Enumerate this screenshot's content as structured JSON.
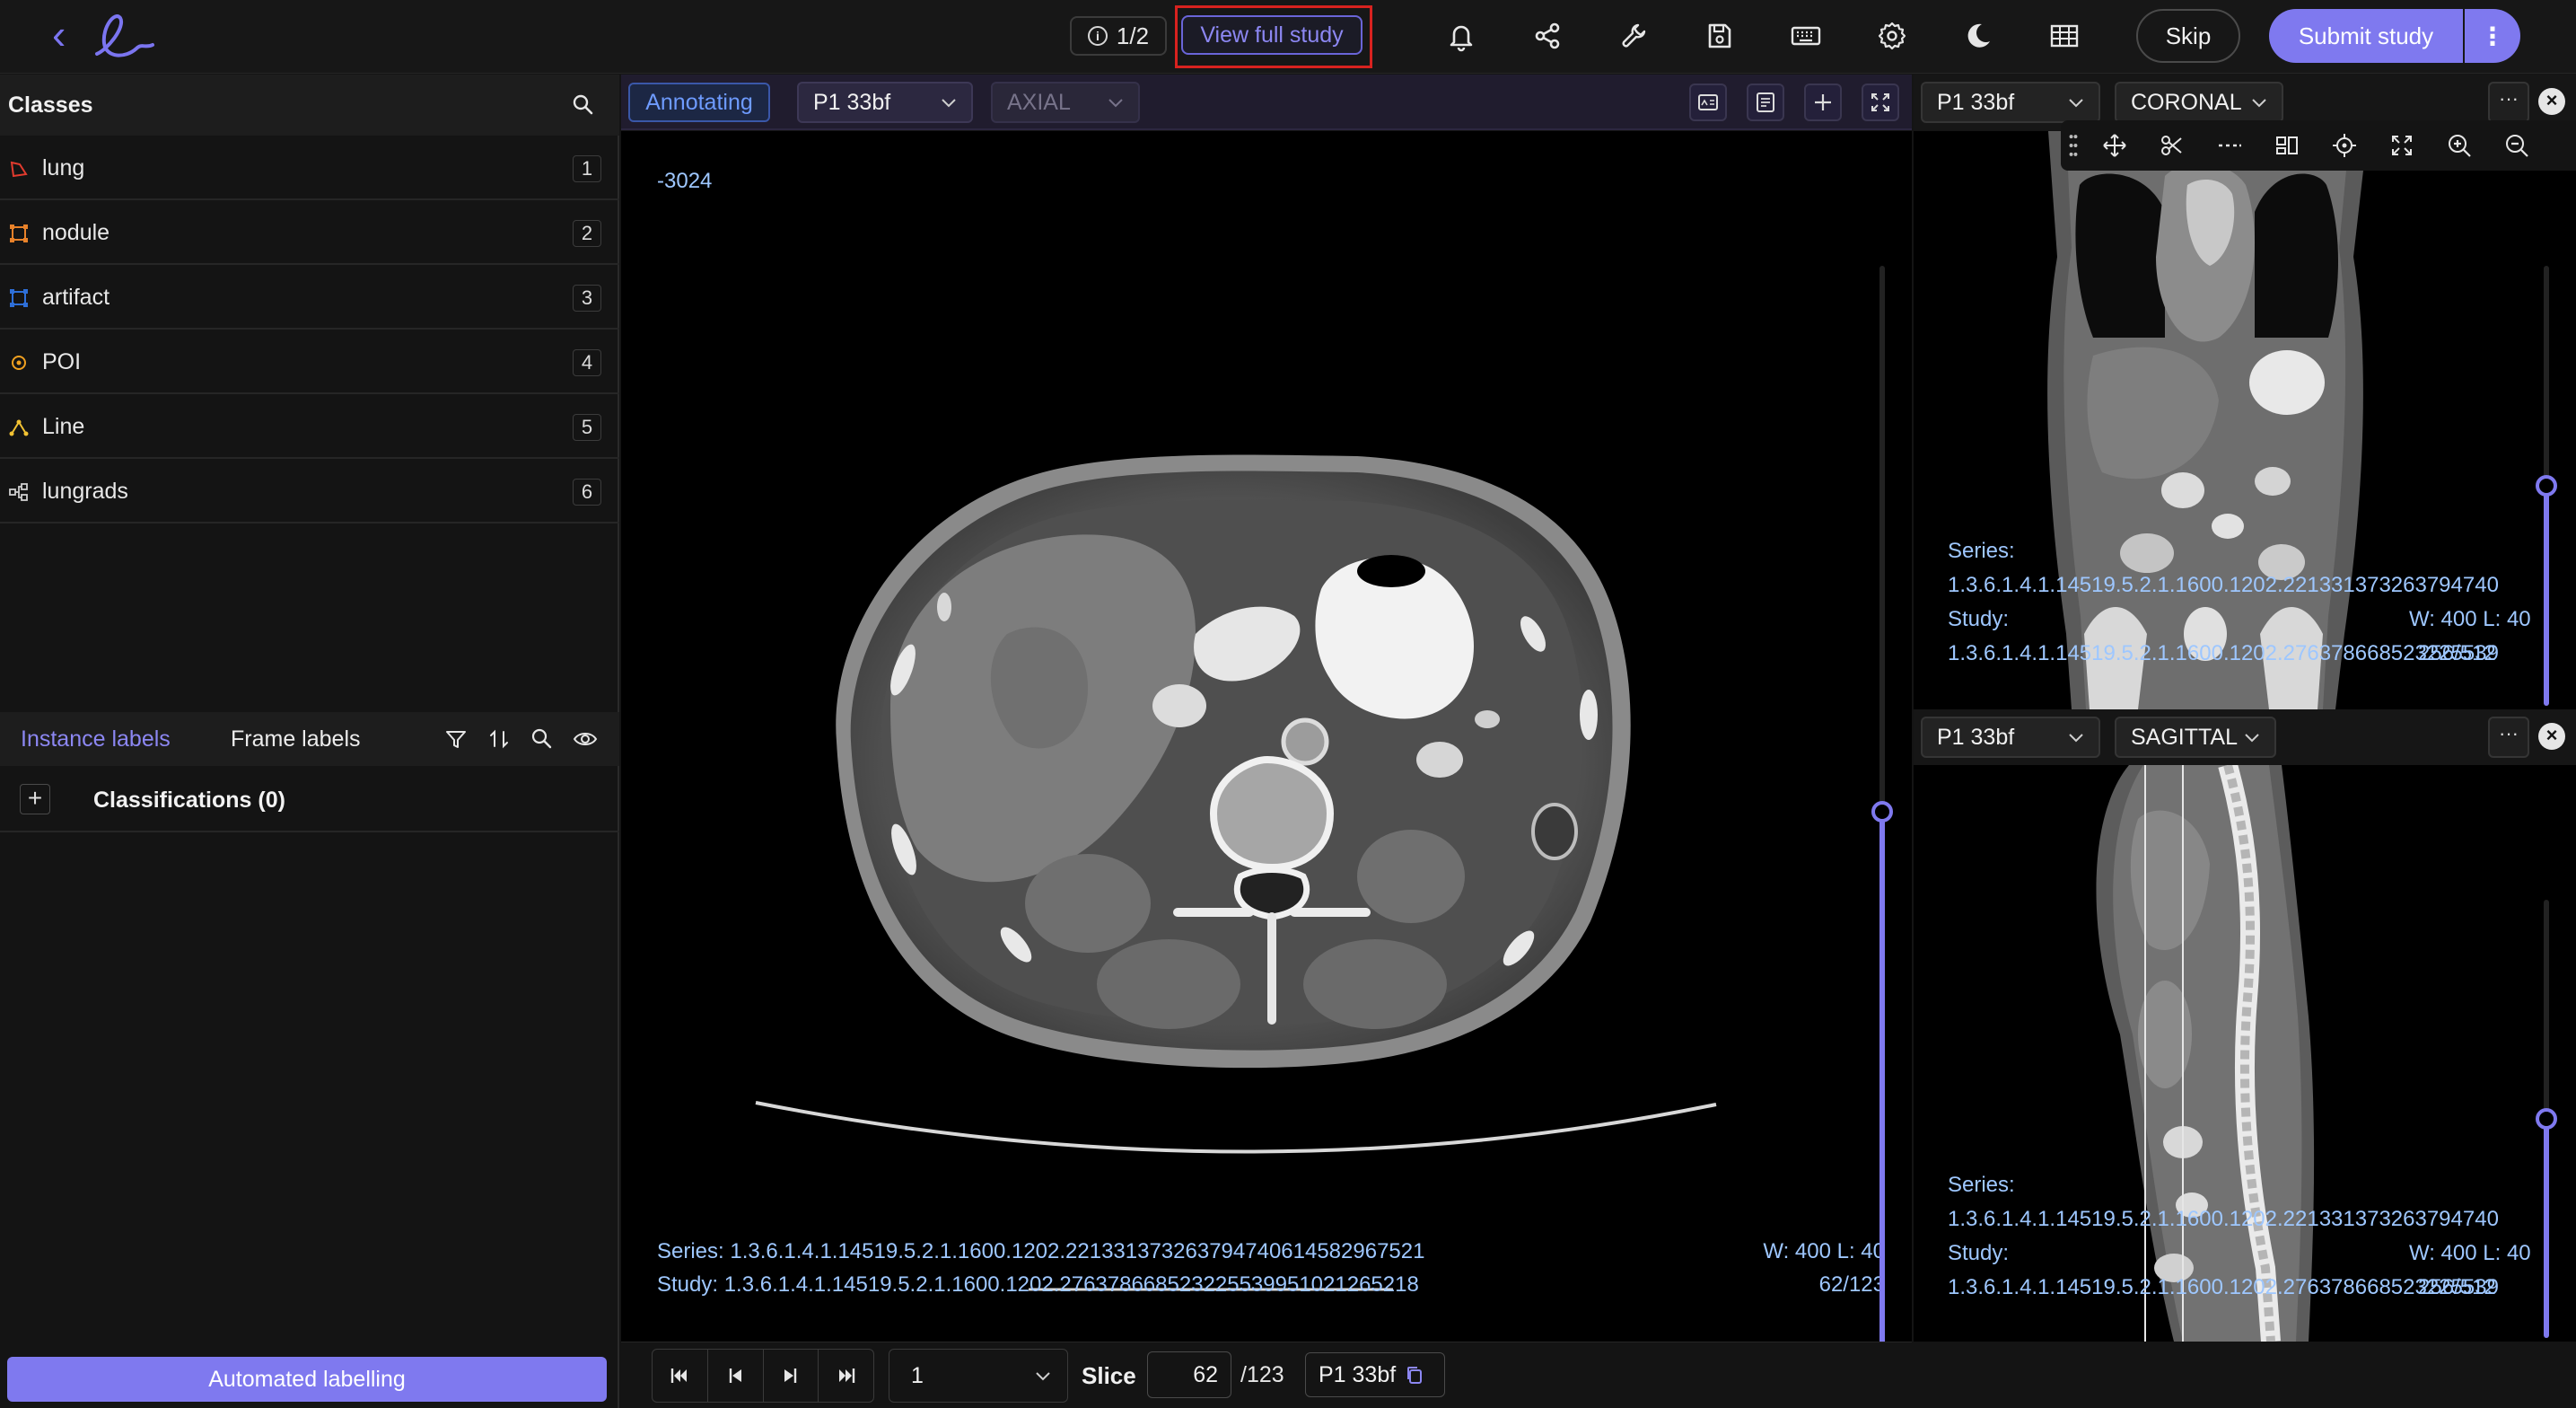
{
  "topbar": {
    "back_icon": "chevron-left-icon",
    "logo": "encord-logo",
    "counter": "1/2",
    "view_full_study": "View full study",
    "icons": [
      "bell-icon",
      "share-icon",
      "wrench-icon",
      "save-icon",
      "keyboard-icon",
      "gear-icon",
      "moon-icon",
      "grid-icon"
    ],
    "skip": "Skip",
    "submit": "Submit study",
    "accent": "#7f79ef"
  },
  "classes": {
    "title": "Classes",
    "items": [
      {
        "name": "lung",
        "key": "1",
        "color": "#e23b2e",
        "icon": "polygon-icon"
      },
      {
        "name": "nodule",
        "key": "2",
        "color": "#e8822a",
        "icon": "bbox-icon"
      },
      {
        "name": "artifact",
        "key": "3",
        "color": "#2e6fd8",
        "icon": "bbox-icon"
      },
      {
        "name": "POI",
        "key": "4",
        "color": "#f0a020",
        "icon": "point-icon"
      },
      {
        "name": "Line",
        "key": "5",
        "color": "#f2c233",
        "icon": "polyline-icon"
      },
      {
        "name": "lungrads",
        "key": "6",
        "color": "#cfcfcf",
        "icon": "classification-icon"
      }
    ]
  },
  "labels": {
    "tab_instance": "Instance labels",
    "tab_frame": "Frame labels",
    "classifications": "Classifications (0)"
  },
  "auto_label": "Automated labelling",
  "main": {
    "mode": "Annotating",
    "series_select": "P1 33bf",
    "plane_select": "AXIAL",
    "hu": "-3024",
    "series_line": "Series: 1.3.6.1.4.1.14519.5.2.1.1600.1202.221331373263794740614582967521",
    "study_line": "Study: 1.3.6.1.4.1.14519.5.2.1.1600.1202.276378668523225539951021265218",
    "wl": "W: 400 L: 40",
    "slice_pos": "62/123",
    "slider_fraction": 0.5
  },
  "bottom": {
    "frame": "1",
    "slice_label": "Slice",
    "slice_value": "62",
    "slice_total": "/123",
    "series_chip": "P1 33bf"
  },
  "coronal": {
    "series_select": "P1 33bf",
    "plane_select": "CORONAL",
    "more": "···",
    "close": "×",
    "series_label": "Series:",
    "series_value": "1.3.6.1.4.1.14519.5.2.1.1600.1202.221331373263794740",
    "study_label": "Study:",
    "study_value": "1.3.6.1.4.1.14519.5.2.1.1600.1202.276378668523225539",
    "wl": "W: 400 L: 40",
    "pos": "256/512",
    "slider_fraction": 0.5
  },
  "sagittal": {
    "series_select": "P1 33bf",
    "plane_select": "SAGITTAL",
    "more": "···",
    "close": "×",
    "series_label": "Series:",
    "series_value": "1.3.6.1.4.1.14519.5.2.1.1600.1202.221331373263794740",
    "study_label": "Study:",
    "study_value": "1.3.6.1.4.1.14519.5.2.1.1600.1202.276378668523225539",
    "wl": "W: 400 L: 40",
    "pos": "256/512",
    "slider_fraction": 0.5
  }
}
